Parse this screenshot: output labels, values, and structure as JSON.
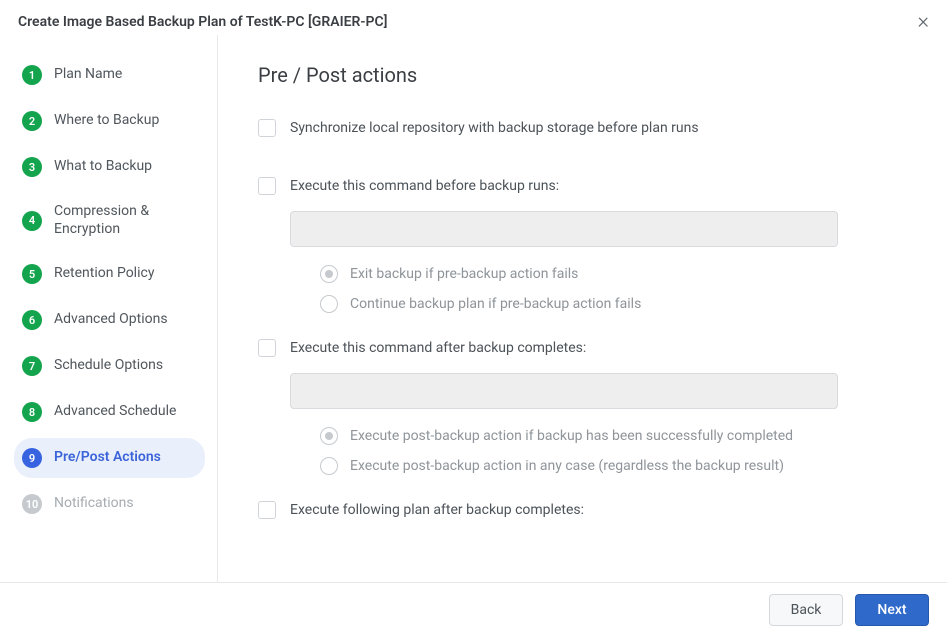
{
  "header": {
    "title": "Create Image Based Backup Plan of TestK-PC [GRAIER-PC]"
  },
  "sidebar": {
    "steps": [
      {
        "num": "1",
        "label": "Plan Name",
        "state": "done"
      },
      {
        "num": "2",
        "label": "Where to Backup",
        "state": "done"
      },
      {
        "num": "3",
        "label": "What to Backup",
        "state": "done"
      },
      {
        "num": "4",
        "label": "Compression & Encryption",
        "state": "done"
      },
      {
        "num": "5",
        "label": "Retention Policy",
        "state": "done"
      },
      {
        "num": "6",
        "label": "Advanced Options",
        "state": "done"
      },
      {
        "num": "7",
        "label": "Schedule Options",
        "state": "done"
      },
      {
        "num": "8",
        "label": "Advanced Schedule",
        "state": "done"
      },
      {
        "num": "9",
        "label": "Pre/Post Actions",
        "state": "active"
      },
      {
        "num": "10",
        "label": "Notifications",
        "state": "disabled"
      }
    ]
  },
  "main": {
    "title": "Pre / Post actions",
    "sync_label": "Synchronize local repository with backup storage before plan runs",
    "pre_cmd_label": "Execute this command before backup runs:",
    "pre_cmd_value": "",
    "pre_radio_exit": "Exit backup if pre-backup action fails",
    "pre_radio_continue": "Continue backup plan if pre-backup action fails",
    "post_cmd_label": "Execute this command after backup completes:",
    "post_cmd_value": "",
    "post_radio_success": "Execute post-backup action if backup has been successfully completed",
    "post_radio_any": "Execute post-backup action in any case (regardless the backup result)",
    "chain_label": "Execute following plan after backup completes:"
  },
  "footer": {
    "back": "Back",
    "next": "Next"
  }
}
